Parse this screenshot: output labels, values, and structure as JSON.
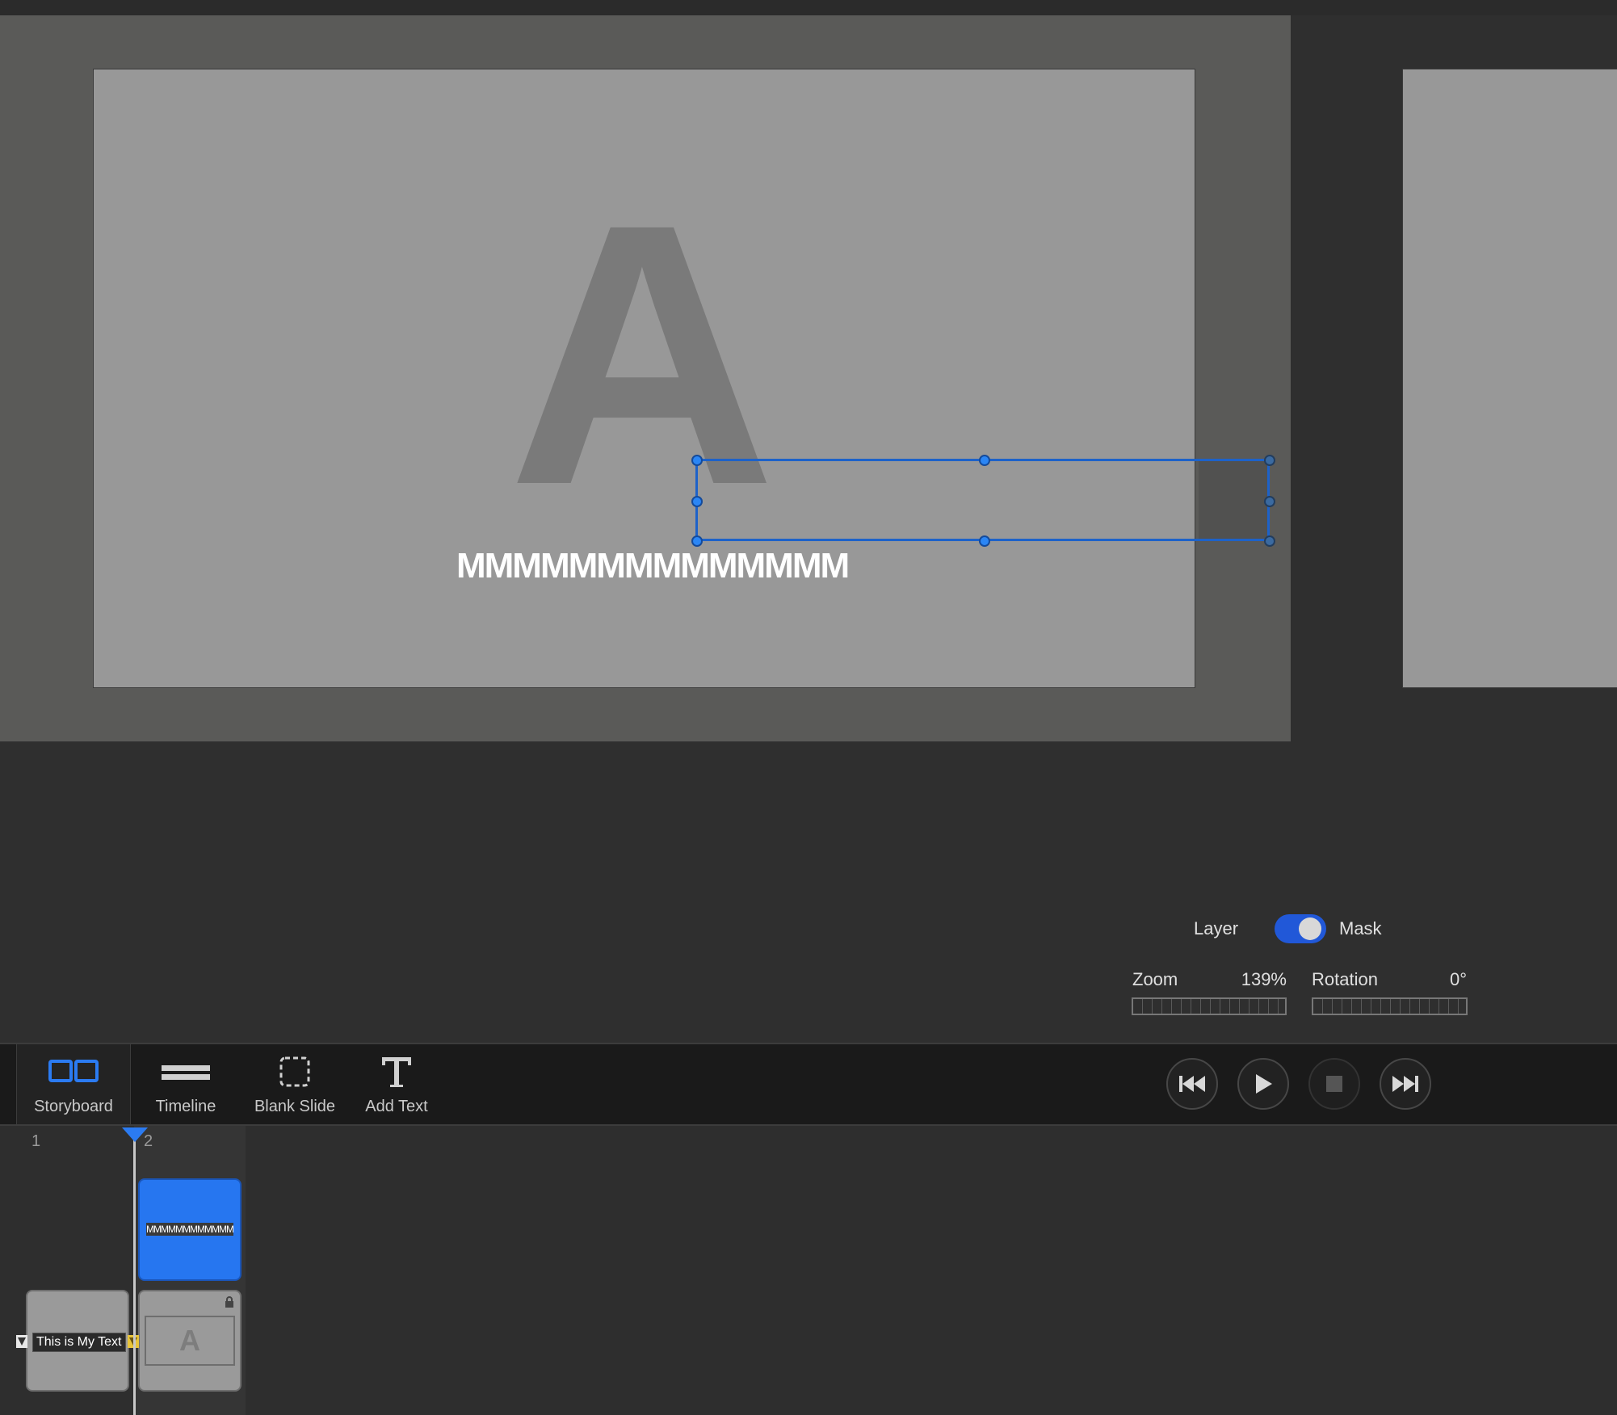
{
  "canvas": {
    "placeholder_letter": "A",
    "text_content": "MMMMMMMMMMMMMM"
  },
  "controls": {
    "layer_label": "Layer",
    "mask_label": "Mask",
    "toggle_state": "mask",
    "zoom": {
      "label": "Zoom",
      "value": "139%"
    },
    "rotation": {
      "label": "Rotation",
      "value": "0°"
    }
  },
  "toolbar": {
    "storyboard_label": "Storyboard",
    "timeline_label": "Timeline",
    "blank_slide_label": "Blank Slide",
    "add_text_label": "Add Text",
    "active_tool": "Storyboard"
  },
  "transport": {
    "rewind_icon": "skip-back-icon",
    "play_icon": "play-icon",
    "stop_icon": "stop-icon",
    "forward_icon": "skip-forward-icon"
  },
  "tracks": {
    "slot_numbers": [
      "1",
      "2"
    ],
    "blue_clip_text": "MMMMMMMMMMMMMM",
    "text_clip_label": "This is My Text",
    "image_clip_letter": "A"
  },
  "colors": {
    "accent": "#2676f0",
    "selection": "#1d62c9",
    "toggle_on": "#2158d8"
  }
}
